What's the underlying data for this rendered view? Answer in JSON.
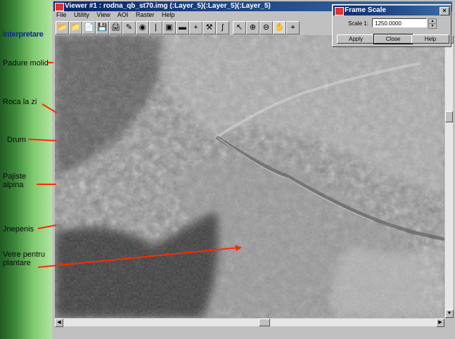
{
  "legend": {
    "title": "Interpretare",
    "labels": [
      {
        "line1": "Padure molid",
        "line2": ""
      },
      {
        "line1": "Roca la zi",
        "line2": ""
      },
      {
        "line1": "Drum",
        "line2": ""
      },
      {
        "line1": "Pajiste",
        "line2": "alpina"
      },
      {
        "line1": "Jnepenis",
        "line2": ""
      },
      {
        "line1": "Vetre pentru",
        "line2": "plantare"
      }
    ]
  },
  "viewer": {
    "title": "Viewer #1 : rodna_qb_st70.img (:Layer_5)(:Layer_5)(:Layer_5)",
    "menu": [
      "File",
      "Utility",
      "View",
      "AOI",
      "Raster",
      "Help"
    ]
  },
  "frame_scale": {
    "title": "Frame Scale",
    "scale_label": "Scale 1:",
    "scale_value": "1250.0000",
    "apply": "Apply",
    "close": "Close",
    "help": "Help"
  },
  "colors": {
    "arrow": "#ff2a00",
    "title_bar": "#0a246a"
  }
}
